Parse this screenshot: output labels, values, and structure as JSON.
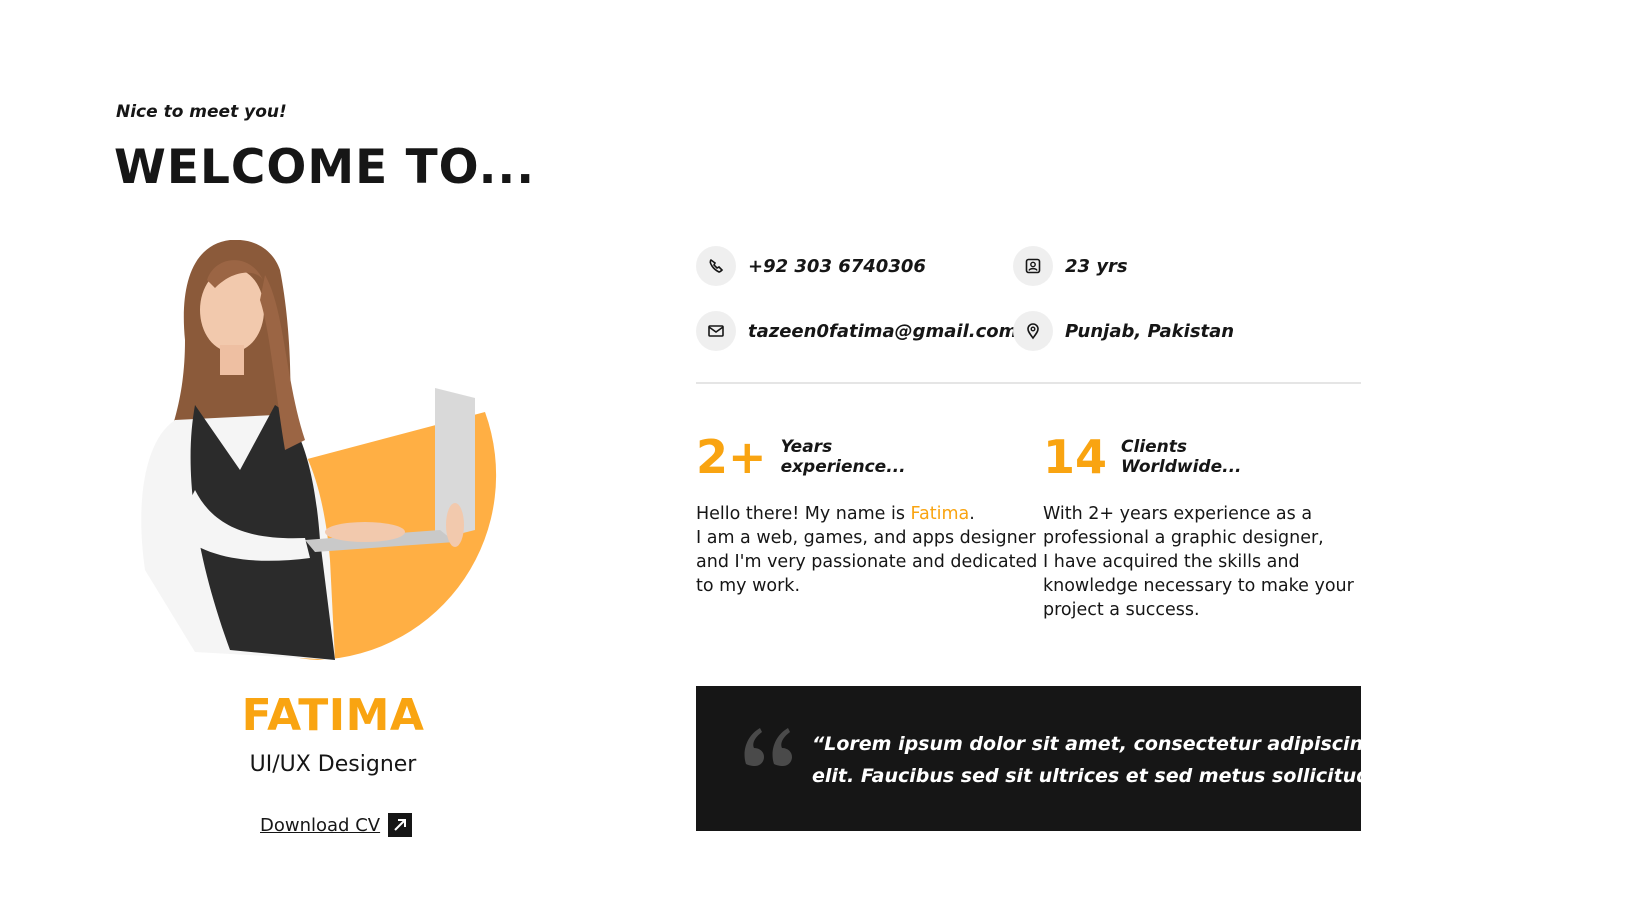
{
  "header": {
    "tagline": "Nice to meet you!",
    "title": "WELCOME TO..."
  },
  "profile": {
    "name": "FATIMA",
    "role": "UI/UX Designer",
    "download_label": "Download CV"
  },
  "contact": {
    "phone": "+92 303 6740306",
    "email": "tazeen0fatima@gmail.com",
    "age": "23 yrs",
    "location": "Punjab, Pakistan"
  },
  "stats": [
    {
      "number": "2+",
      "label_line1": "Years",
      "label_line2": "experience..."
    },
    {
      "number": "14",
      "label_line1": "Clients",
      "label_line2": "Worldwide..."
    }
  ],
  "about": {
    "intro_before": "Hello there! My name is ",
    "intro_name": "Fatima",
    "intro_after": ".",
    "line2": "I am a web, games, and apps designer",
    "line3": "and I'm very passionate and dedicated",
    "line4": "to my work."
  },
  "experience": {
    "line1": "With 2+ years experience as a",
    "line2": "professional a graphic designer,",
    "line3": "I have acquired the skills and",
    "line4": "knowledge necessary to make your",
    "line5": "project a success."
  },
  "quote": {
    "line1": "“Lorem ipsum dolor sit amet, consectetur adipiscing",
    "line2": "elit. Faucibus sed sit ultrices et sed metus sollicitudin.”"
  },
  "colors": {
    "accent": "#f9a411",
    "dark": "#161616",
    "icon_bg": "#efefef"
  }
}
